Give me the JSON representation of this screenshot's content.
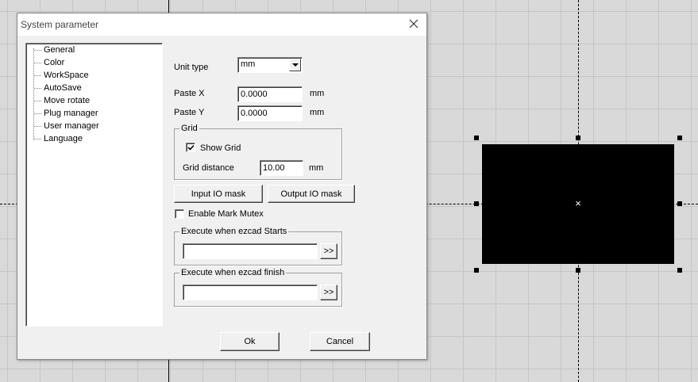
{
  "dialog": {
    "title": "System parameter",
    "tree_items": [
      "General",
      "Color",
      "WorkSpace",
      "AutoSave",
      "Move rotate",
      "Plug manager",
      "User manager",
      "Language"
    ],
    "unit_type": {
      "label": "Unit type",
      "value": "mm"
    },
    "paste_x": {
      "label": "Paste X",
      "value": "0.0000",
      "unit": "mm"
    },
    "paste_y": {
      "label": "Paste Y",
      "value": "0.0000",
      "unit": "mm"
    },
    "grid": {
      "title": "Grid",
      "show_grid_label": "Show Grid",
      "show_grid_checked": true,
      "distance_label": "Grid distance",
      "distance_value": "10.00",
      "distance_unit": "mm"
    },
    "input_io_mask_label": "Input IO mask",
    "output_io_mask_label": "Output IO mask",
    "enable_mark_mutex_label": "Enable Mark Mutex",
    "enable_mark_mutex_checked": false,
    "execute_start": {
      "title": "Execute when ezcad Starts",
      "value": "",
      "browse_label": ">>"
    },
    "execute_finish": {
      "title": "Execute when ezcad finish",
      "value": "",
      "browse_label": ">>"
    },
    "ok_label": "Ok",
    "cancel_label": "Cancel"
  },
  "canvas": {
    "background_color": "#d9d9d9",
    "shape_color": "#000000",
    "center_mark": "×"
  }
}
